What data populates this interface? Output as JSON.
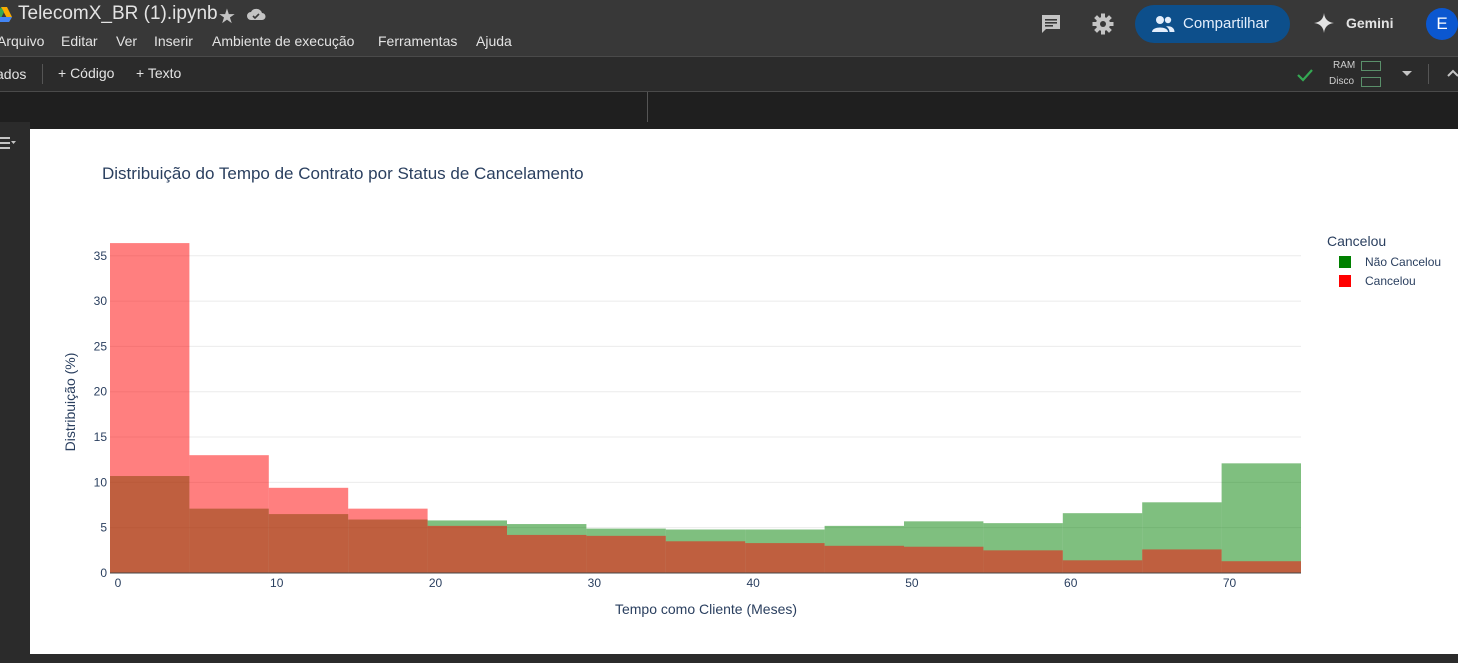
{
  "header": {
    "doc_title": "TelecomX_BR (1).ipynb",
    "menu": [
      "Arquivo",
      "Editar",
      "Ver",
      "Inserir",
      "Ambiente de execução",
      "Ferramentas",
      "Ajuda"
    ],
    "share_label": "Compartilhar",
    "gemini_label": "Gemini",
    "avatar_initial": "E"
  },
  "toolbar": {
    "cut_label": "ados",
    "add_code": "+ Código",
    "add_text": "+ Texto",
    "ram_label": "RAM",
    "disk_label": "Disco"
  },
  "colors": {
    "nao_cancelou": "#008000",
    "cancelou": "#ff0000",
    "accent": "#0d4f8b"
  },
  "chart_data": {
    "type": "bar",
    "title": "Distribuição do Tempo de Contrato por Status de Cancelamento",
    "xlabel": "Tempo como Cliente (Meses)",
    "ylabel": "Distribuição (%)",
    "xlim": [
      -0.5,
      74.5
    ],
    "ylim": [
      0,
      36.3
    ],
    "xticks": [
      0,
      10,
      20,
      30,
      40,
      50,
      60,
      70
    ],
    "yticks": [
      0,
      5,
      10,
      15,
      20,
      25,
      30,
      35
    ],
    "bins": [
      [
        -0.5,
        4.5
      ],
      [
        4.5,
        9.5
      ],
      [
        9.5,
        14.5
      ],
      [
        14.5,
        19.5
      ],
      [
        19.5,
        24.5
      ],
      [
        24.5,
        29.5
      ],
      [
        29.5,
        34.5
      ],
      [
        34.5,
        39.5
      ],
      [
        39.5,
        44.5
      ],
      [
        44.5,
        49.5
      ],
      [
        49.5,
        54.5
      ],
      [
        54.5,
        59.5
      ],
      [
        59.5,
        64.5
      ],
      [
        64.5,
        69.5
      ],
      [
        69.5,
        74.5
      ]
    ],
    "legend_title": "Cancelou",
    "legend_position": "top-right",
    "grid": true,
    "series": [
      {
        "name": "Não Cancelou",
        "values": [
          10.7,
          7.1,
          6.5,
          5.9,
          5.8,
          5.4,
          4.9,
          4.8,
          4.8,
          5.2,
          5.7,
          5.5,
          6.6,
          7.8,
          12.1
        ]
      },
      {
        "name": "Cancelou",
        "values": [
          36.4,
          13.0,
          9.4,
          7.1,
          5.2,
          4.2,
          4.1,
          3.5,
          3.3,
          3.0,
          2.9,
          2.5,
          1.4,
          2.6,
          1.3
        ]
      }
    ]
  }
}
